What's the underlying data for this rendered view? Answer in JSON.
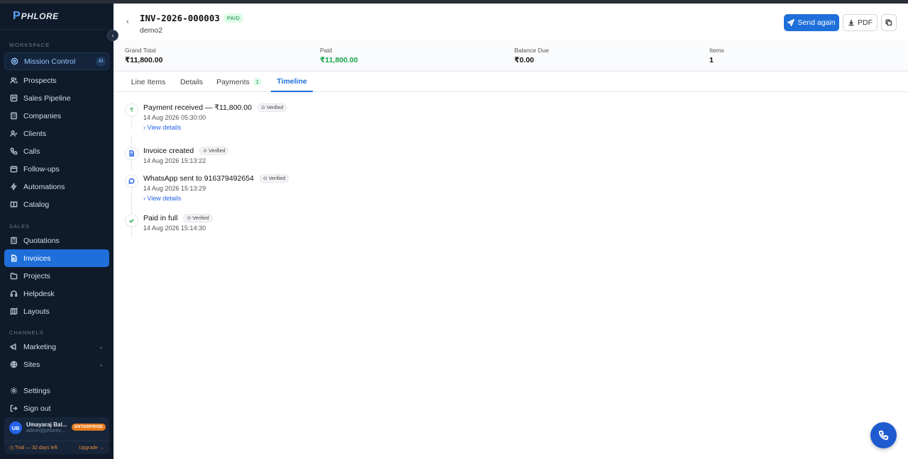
{
  "sidebar": {
    "brand": "PHLORE",
    "sections": {
      "workspace": "WORKSPACE",
      "sales": "SALES",
      "channels": "CHANNELS"
    },
    "mission": {
      "label": "Mission Control",
      "badge": "AI"
    },
    "workspace_items": [
      "Prospects",
      "Sales Pipeline",
      "Companies",
      "Clients",
      "Calls",
      "Follow-ups",
      "Automations",
      "Catalog"
    ],
    "sales_items": [
      "Quotations",
      "Invoices",
      "Projects",
      "Helpdesk",
      "Layouts"
    ],
    "channel_items": [
      "Marketing",
      "Sites"
    ],
    "bottom_items": [
      "Settings",
      "Sign out"
    ],
    "user": {
      "initials": "UB",
      "name": "Umayaraj Bal...",
      "email": "admin@phlorex....",
      "plan": "ENTERPRISE",
      "trial": "◷ Trial — 32 days left",
      "upgrade": "Upgrade →"
    }
  },
  "header": {
    "invoice_no": "INV-2026-000003",
    "status": "PAID",
    "client": "demo2",
    "send_again": "Send again",
    "pdf": "PDF"
  },
  "summary": [
    {
      "label": "Grand Total",
      "value": "₹11,800.00"
    },
    {
      "label": "Paid",
      "value": "₹11,800.00"
    },
    {
      "label": "Balance Due",
      "value": "₹0.00"
    },
    {
      "label": "Items",
      "value": "1"
    }
  ],
  "tabs": {
    "line_items": "Line Items",
    "details": "Details",
    "payments": "Payments",
    "payments_count": "1",
    "timeline": "Timeline"
  },
  "timeline": [
    {
      "title": "Payment received — ₹11,800.00",
      "badge": "Verified",
      "time": "14 Aug 2026 05:30:00",
      "link": "View details",
      "icon": "rupee-icon"
    },
    {
      "title": "Invoice created",
      "badge": "Verified",
      "time": "14 Aug 2026 15:13:22",
      "icon": "document-icon"
    },
    {
      "title": "WhatsApp sent to 916379492654",
      "badge": "Verified",
      "time": "14 Aug 2026 15:13:29",
      "link": "View details",
      "icon": "chat-icon"
    },
    {
      "title": "Paid in full",
      "badge": "Verified",
      "time": "14 Aug 2026 15:14:30",
      "icon": "check-icon"
    }
  ],
  "colors": {
    "accent": "#1e6fd9",
    "sidebar": "#0f1b2a",
    "paid": "#16a34a"
  }
}
